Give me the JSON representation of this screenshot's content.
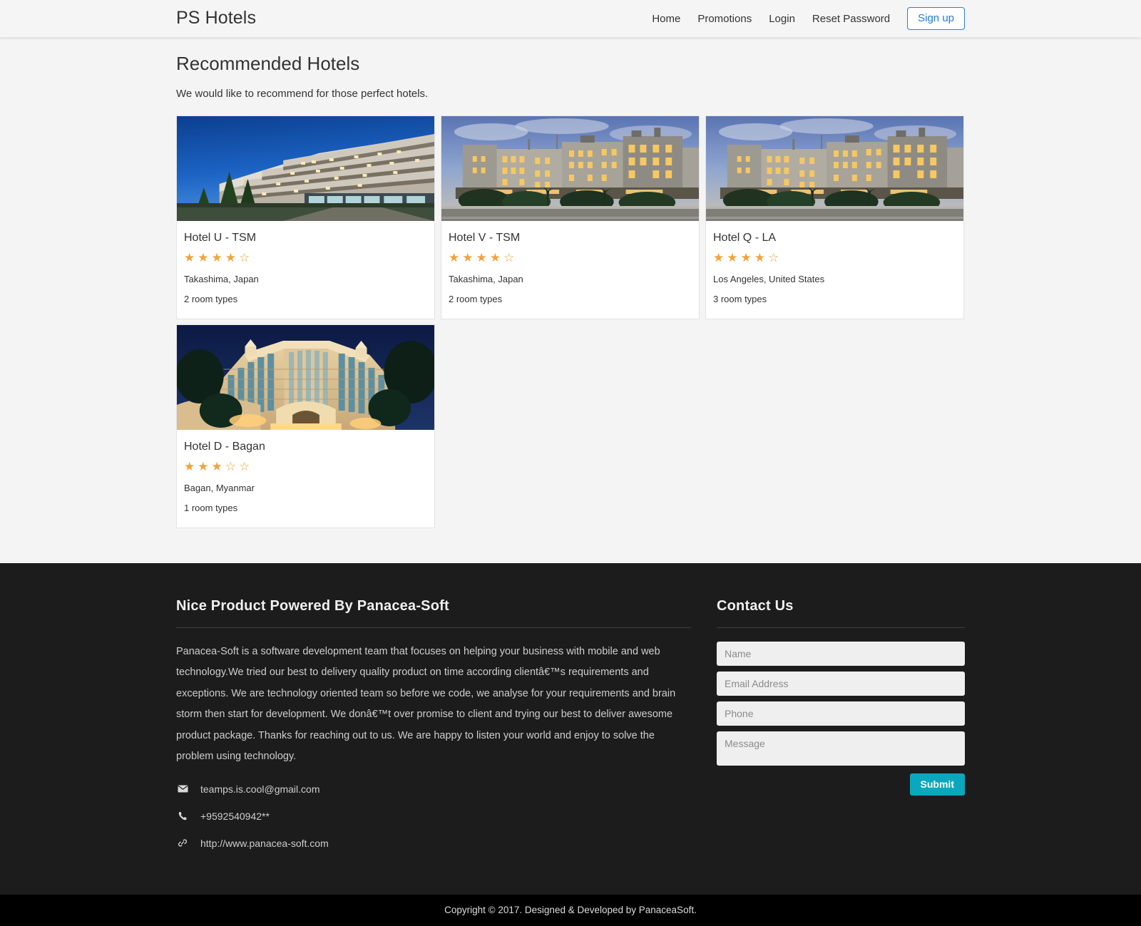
{
  "header": {
    "brand": "PS Hotels",
    "nav": [
      {
        "label": "Home"
      },
      {
        "label": "Promotions"
      },
      {
        "label": "Login"
      },
      {
        "label": "Reset Password"
      }
    ],
    "signup_label": "Sign up",
    "signup_color": "#1f7ae0"
  },
  "main": {
    "title": "Recommended Hotels",
    "subtitle": "We would like to recommend for those perfect hotels.",
    "hotels": [
      {
        "name": "Hotel U - TSM",
        "rating": 4,
        "max_rating": 5,
        "location": "Takashima, Japan",
        "rooms": "2 room types",
        "image": "modern-hotel-blue-sky"
      },
      {
        "name": "Hotel V - TSM",
        "rating": 4,
        "max_rating": 5,
        "location": "Takashima, Japan",
        "rooms": "2 room types",
        "image": "evening-hotel-lit-windows"
      },
      {
        "name": "Hotel Q - LA",
        "rating": 4,
        "max_rating": 5,
        "location": "Los Angeles, United States",
        "rooms": "3 room types",
        "image": "evening-hotel-lit-windows"
      },
      {
        "name": "Hotel D - Bagan",
        "rating": 3,
        "max_rating": 5,
        "location": "Bagan, Myanmar",
        "rooms": "1 room types",
        "image": "grand-ornate-hotel-night"
      }
    ],
    "star_color": "#f2a33c"
  },
  "footer": {
    "about_heading": "Nice Product Powered By Panacea-Soft",
    "about_text": "Panacea-Soft is a software development team that focuses on helping your business with mobile and web technology.We tried our best to delivery quality product on time according clientâ€™s requirements and exceptions. We are technology oriented team so before we code, we analyse for your requirements and brain storm then start for development. We donâ€™t over promise to client and trying our best to deliver awesome product package. Thanks for reaching out to us. We are happy to listen your world and enjoy to solve the problem using technology.",
    "contacts": [
      {
        "icon": "envelope-icon",
        "value": "teamps.is.cool@gmail.com"
      },
      {
        "icon": "phone-icon",
        "value": "+9592540942**"
      },
      {
        "icon": "link-icon",
        "value": "http://www.panacea-soft.com"
      }
    ],
    "contact_heading": "Contact Us",
    "form": {
      "name_placeholder": "Name",
      "name_value": "",
      "email_placeholder": "Email Address",
      "email_value": "",
      "phone_placeholder": "Phone",
      "phone_value": "",
      "message_placeholder": "Message",
      "message_value": "",
      "submit_label": "Submit",
      "submit_color": "#0aa7bd"
    },
    "copyright": "Copyright © 2017. Designed & Developed by PanaceaSoft."
  }
}
